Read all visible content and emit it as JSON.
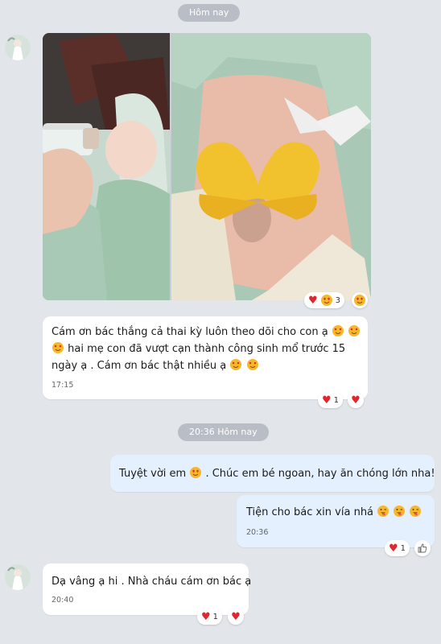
{
  "date_pill": "Hôm nay",
  "time_pill": "20:36 Hôm nay",
  "colors": {
    "background": "#e2e5ea",
    "incoming_bubble": "#ffffff",
    "outgoing_bubble": "#e4f0fd",
    "heart": "#e0262f"
  },
  "photo_post": {
    "reactions": {
      "icons": [
        "heart-icon",
        "heart-eyes-face-icon"
      ],
      "count": "3"
    }
  },
  "messages": [
    {
      "id": "m1",
      "direction": "incoming",
      "line1": "Cám ơn bác thắng cả thai kỳ luôn theo dõi cho con ạ",
      "line2": "hai mẹ con đã vượt cạn thành công sinh mổ trước 15",
      "line3": "ngày ạ . Cám ơn bác thật nhiều ạ",
      "time": "17:15",
      "reaction_count": "1"
    },
    {
      "id": "m2",
      "direction": "outgoing",
      "part1": "Tuyệt vời em",
      "part2": ". Chúc em bé ngoan, hay ăn chóng lớn nha!"
    },
    {
      "id": "m3",
      "direction": "outgoing",
      "text": "Tiện cho bác xin vía nhá",
      "time": "20:36",
      "reaction_count": "1"
    },
    {
      "id": "m4",
      "direction": "incoming",
      "text": "Dạ vâng ạ hi . Nhà cháu cám ơn bác ạ",
      "time": "20:40",
      "reaction_count": "1"
    }
  ]
}
